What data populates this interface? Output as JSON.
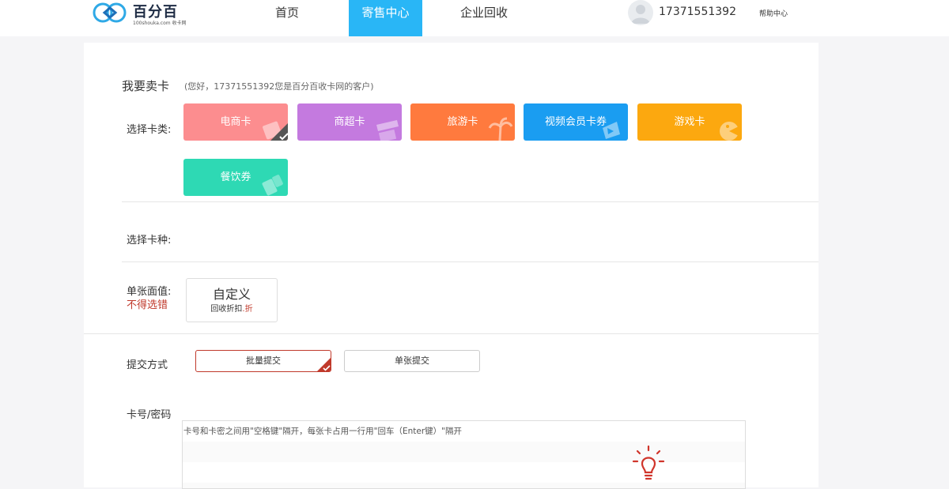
{
  "header": {
    "logo_text": "百分百",
    "logo_sub": "100shouka.com 收卡网",
    "nav": [
      {
        "label": "首页"
      },
      {
        "label": "寄售中心"
      },
      {
        "label": "企业回收"
      }
    ],
    "active_nav": "寄售中心",
    "user_phone": "17371551392",
    "help_label": "帮助中心"
  },
  "main": {
    "title": "我要卖卡",
    "greeting": "(您好，17371551392您是百分百收卡网的客户)",
    "card_type_label": "选择卡类:",
    "card_types": [
      {
        "label": "电商卡",
        "color": "#fc8d8f",
        "icon": "shopping-bag-icon",
        "selected": true
      },
      {
        "label": "商超卡",
        "color": "#c47adf",
        "icon": "store-icon",
        "selected": false
      },
      {
        "label": "旅游卡",
        "color": "#ff7a3e",
        "icon": "palm-tree-icon",
        "selected": false
      },
      {
        "label": "视频会员卡券",
        "color": "#1a9df1",
        "icon": "video-camera-icon",
        "selected": false
      },
      {
        "label": "游戏卡",
        "color": "#fca80f",
        "icon": "game-face-icon",
        "selected": false
      },
      {
        "label": "餐饮券",
        "color": "#2ed9b4",
        "icon": "drink-icon",
        "selected": false
      }
    ],
    "card_kind_label": "选择卡种:",
    "face_value_label": "单张面值:",
    "face_value_warning": "不得选错",
    "face_value_option": {
      "title": "自定义",
      "sub_prefix": "回收折扣",
      "sub_suffix": ".折"
    },
    "submit_mode_label": "提交方式",
    "submit_modes": [
      {
        "label": "批量提交",
        "selected": true
      },
      {
        "label": "单张提交",
        "selected": false
      }
    ],
    "card_input_label": "卡号/密码",
    "card_input_placeholder": "卡号和卡密之间用\"空格键\"隔开，每张卡占用一行用\"回车（Enter键）\"隔开"
  },
  "colors": {
    "accent": "#29b6f6",
    "warning": "#c0392b"
  }
}
